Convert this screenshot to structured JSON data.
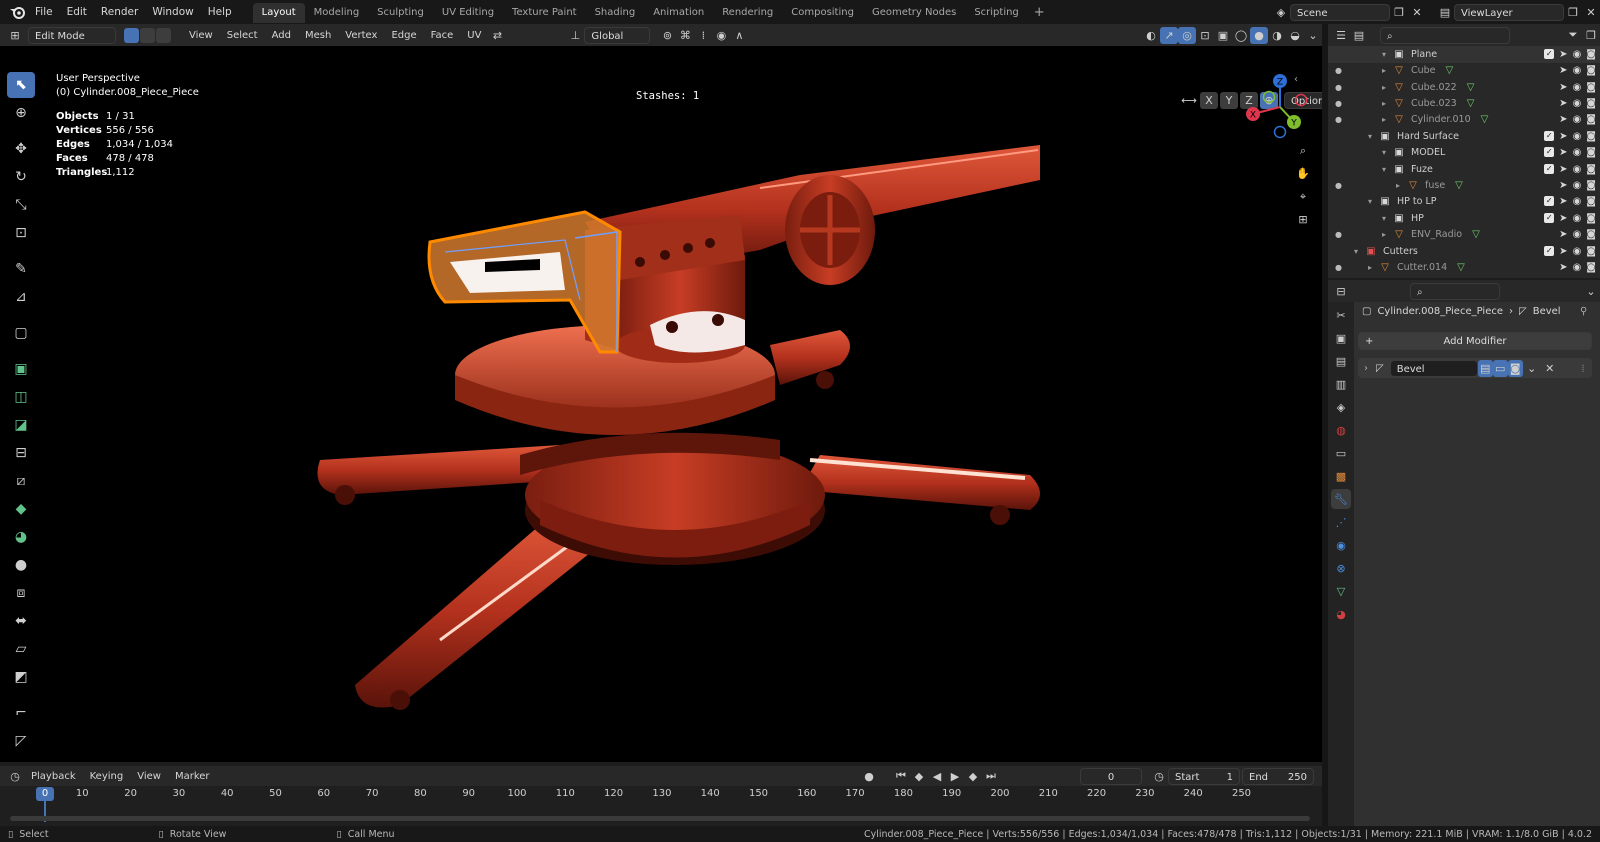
{
  "menubar": {
    "menus": [
      "File",
      "Edit",
      "Render",
      "Window",
      "Help"
    ],
    "workspaces": [
      "Layout",
      "Modeling",
      "Sculpting",
      "UV Editing",
      "Texture Paint",
      "Shading",
      "Animation",
      "Rendering",
      "Compositing",
      "Geometry Nodes",
      "Scripting"
    ],
    "active_workspace": "Layout",
    "scene": "Scene",
    "view_layer": "ViewLayer"
  },
  "viewport_header": {
    "mode": "Edit Mode",
    "menus": [
      "View",
      "Select",
      "Add",
      "Mesh",
      "Vertex",
      "Edge",
      "Face",
      "UV"
    ],
    "transform_orientation": "Global",
    "stashes_label": "Stashes: 1",
    "axes": [
      "X",
      "Y",
      "Z"
    ],
    "options_label": "Options"
  },
  "stats": {
    "perspective": "User Perspective",
    "object_name": "(0) Cylinder.008_Piece_Piece",
    "rows": [
      {
        "k": "Objects",
        "v": "1 / 31"
      },
      {
        "k": "Vertices",
        "v": "556 / 556"
      },
      {
        "k": "Edges",
        "v": "1,034 / 1,034"
      },
      {
        "k": "Faces",
        "v": "478 / 478"
      },
      {
        "k": "Triangles",
        "v": "1,112"
      }
    ]
  },
  "gizmo": {
    "x": "X",
    "y": "Y",
    "z": "Z"
  },
  "outliner": {
    "rows": [
      {
        "name": "Plane",
        "icon": "collection",
        "indent": 3,
        "hl": true
      },
      {
        "name": "Cube",
        "icon": "mesh",
        "indent": 3
      },
      {
        "name": "Cube.022",
        "icon": "mesh",
        "indent": 3
      },
      {
        "name": "Cube.023",
        "icon": "mesh",
        "indent": 3
      },
      {
        "name": "Cylinder.010",
        "icon": "mesh",
        "indent": 3
      },
      {
        "name": "Hard Surface",
        "icon": "collection",
        "indent": 2
      },
      {
        "name": "MODEL",
        "icon": "collection",
        "indent": 3
      },
      {
        "name": "Fuze",
        "icon": "collection",
        "indent": 3
      },
      {
        "name": "fuse",
        "icon": "mesh",
        "indent": 4
      },
      {
        "name": "HP to LP",
        "icon": "collection",
        "indent": 2
      },
      {
        "name": "HP",
        "icon": "collection",
        "indent": 3
      },
      {
        "name": "ENV_Radio",
        "icon": "mesh",
        "indent": 3
      },
      {
        "name": "Cutters",
        "icon": "collection-red",
        "indent": 1
      },
      {
        "name": "Cutter.014",
        "icon": "mesh",
        "indent": 2
      }
    ]
  },
  "properties": {
    "breadcrumb_object": "Cylinder.008_Piece_Piece",
    "breadcrumb_modifier": "Bevel",
    "add_modifier_label": "Add Modifier",
    "modifier_name": "Bevel"
  },
  "timeline": {
    "menus": [
      "Playback",
      "Keying",
      "View",
      "Marker"
    ],
    "current_frame": "0",
    "start_label": "Start",
    "start": "1",
    "end_label": "End",
    "end": "250",
    "ticks": [
      "10",
      "20",
      "30",
      "40",
      "50",
      "60",
      "70",
      "80",
      "90",
      "100",
      "110",
      "120",
      "130",
      "140",
      "150",
      "160",
      "170",
      "180",
      "190",
      "200",
      "210",
      "220",
      "230",
      "240",
      "250"
    ],
    "playhead": "0"
  },
  "statusbar": {
    "select": "Select",
    "rotate": "Rotate View",
    "call_menu": "Call Menu",
    "info": "Cylinder.008_Piece_Piece | Verts:556/556 | Edges:1,034/1,034 | Faces:478/478 | Tris:1,112 | Objects:1/31 | Memory: 221.1 MiB | VRAM: 1.1/8.0 GiB | 4.0.2"
  },
  "colors": {
    "accent": "#4772b3",
    "model": "#c0392b",
    "selection": "#ff8a00"
  }
}
